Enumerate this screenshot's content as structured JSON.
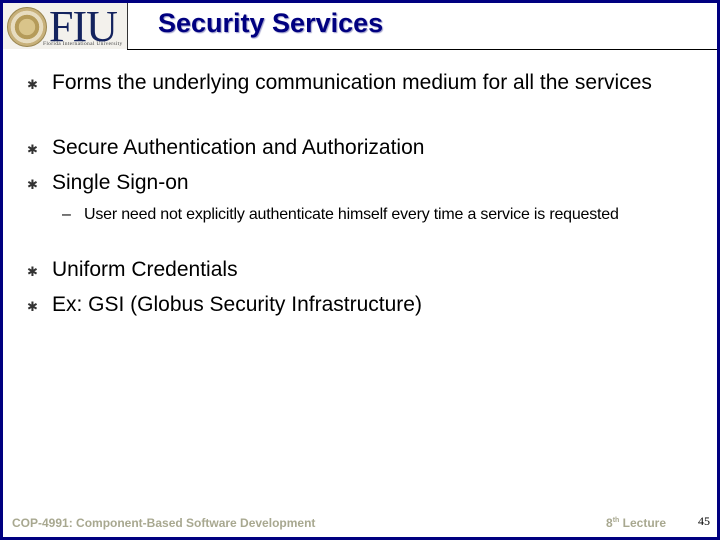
{
  "header": {
    "logo_text": "FIU",
    "logo_subtitle": "Florida International University",
    "title": "Security Services"
  },
  "bullets": [
    {
      "text": "Forms the underlying communication medium for all the services"
    },
    {
      "text": "Secure Authentication and Authorization"
    },
    {
      "text": "Single Sign-on"
    },
    {
      "sub": true,
      "text": "User need not explicitly authenticate himself every time a service is requested"
    },
    {
      "text": "Uniform Credentials"
    },
    {
      "text": "Ex: GSI (Globus Security Infrastructure)"
    }
  ],
  "bullet_icon": "asterisk-bullet",
  "sub_bullet_icon": "dash",
  "footer": {
    "course": "COP-4991: Component-Based Software Development",
    "lecture_num": "8",
    "lecture_suffix": "th",
    "lecture_label": "Lecture",
    "page": "45"
  },
  "colors": {
    "frame": "#000080",
    "title": "#000080",
    "footer_text": "#a8a890"
  }
}
